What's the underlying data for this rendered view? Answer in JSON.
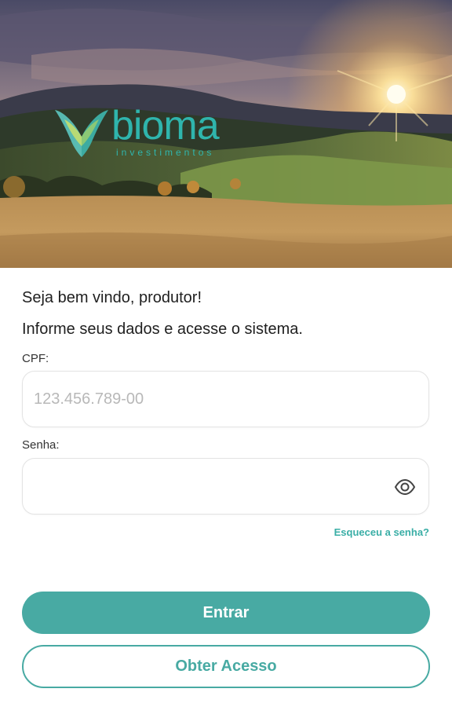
{
  "hero": {
    "logo": {
      "name": "bioma",
      "tagline": "investimentos",
      "color": "#2fb5ad"
    }
  },
  "login": {
    "welcome": "Seja bem vindo, produtor!",
    "instruction": "Informe seus dados e acesse o sistema.",
    "cpf": {
      "label": "CPF:",
      "value": "",
      "placeholder": "123.456.789-00"
    },
    "password": {
      "label": "Senha:",
      "value": "",
      "placeholder": "",
      "toggle_icon": "eye-icon"
    },
    "forgot_link": "Esqueceu a senha?",
    "submit_label": "Entrar",
    "request_access_label": "Obter Acesso"
  },
  "colors": {
    "accent": "#48aaa3",
    "link": "#3aaea6",
    "text": "#1f1f1f"
  }
}
